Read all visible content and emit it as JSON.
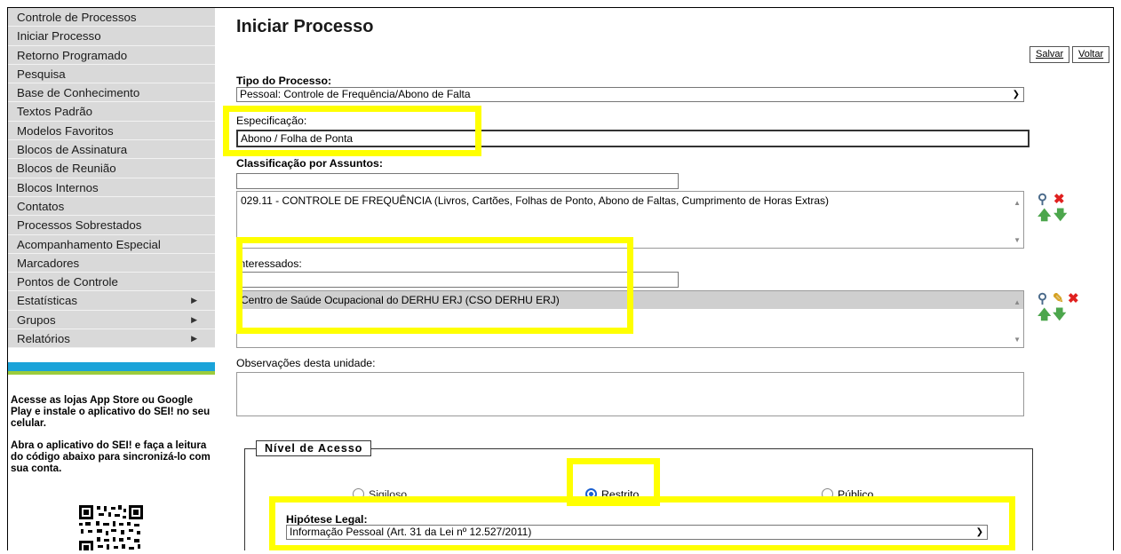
{
  "sidebar": {
    "items": [
      {
        "label": "Controle de Processos"
      },
      {
        "label": "Iniciar Processo"
      },
      {
        "label": "Retorno Programado"
      },
      {
        "label": "Pesquisa"
      },
      {
        "label": "Base de Conhecimento"
      },
      {
        "label": "Textos Padrão"
      },
      {
        "label": "Modelos Favoritos"
      },
      {
        "label": "Blocos de Assinatura"
      },
      {
        "label": "Blocos de Reunião"
      },
      {
        "label": "Blocos Internos"
      },
      {
        "label": "Contatos"
      },
      {
        "label": "Processos Sobrestados"
      },
      {
        "label": "Acompanhamento Especial"
      },
      {
        "label": "Marcadores"
      },
      {
        "label": "Pontos de Controle"
      },
      {
        "label": "Estatísticas",
        "arrow": "▶"
      },
      {
        "label": "Grupos",
        "arrow": "▶"
      },
      {
        "label": "Relatórios",
        "arrow": "▶"
      }
    ],
    "promo_1": "Acesse as lojas App Store ou Google Play e instale o aplicativo do SEI! no seu celular.",
    "promo_2": "Abra o aplicativo do SEI! e faça a leitura do código abaixo para sincronizá-lo com sua conta."
  },
  "page": {
    "title": "Iniciar Processo",
    "save_label": "Salvar",
    "back_label": "Voltar"
  },
  "form": {
    "tipo_label": "Tipo do Processo:",
    "tipo_value": "Pessoal: Controle de Frequência/Abono de Falta",
    "especificacao_label": "Especificação:",
    "especificacao_value": "Abono / Folha de Ponta",
    "classificacao_label": "Classificação por Assuntos:",
    "classificacao_search": "",
    "classificacao_items": [
      "029.11 - CONTROLE DE FREQUÊNCIA (Livros, Cartões, Folhas de Ponto, Abono de Faltas, Cumprimento de Horas Extras)"
    ],
    "interessados_label": "Interessados:",
    "interessados_search": "",
    "interessados_items": [
      "Centro de Saúde Ocupacional do DERHU ERJ (CSO DERHU ERJ)"
    ],
    "observacoes_label": "Observações desta unidade:",
    "observacoes_value": ""
  },
  "acesso": {
    "legend": "Nível de Acesso",
    "options": [
      "Sigiloso",
      "Restrito",
      "Público"
    ],
    "selected": "Restrito",
    "hipotese_label": "Hipótese Legal:",
    "hipotese_value": "Informação Pessoal (Art. 31 da Lei nº 12.527/2011)"
  },
  "colors": {
    "highlight": "#ffff00",
    "menu_bg": "#d9d9d9",
    "stripe_blue": "#1aa3d9",
    "stripe_green": "#9ccc3c",
    "radio_on": "#1a5fd0"
  }
}
